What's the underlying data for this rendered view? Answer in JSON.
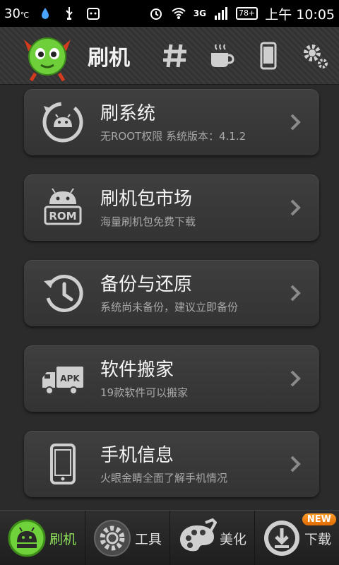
{
  "status_bar": {
    "temperature": "30",
    "network": "3G",
    "battery": "78+",
    "time": "上午 10:05"
  },
  "header": {
    "title": "刷机",
    "icons": [
      "hash-icon",
      "coffee-icon",
      "phone-icon",
      "gear-icon"
    ]
  },
  "cards": [
    {
      "title": "刷系统",
      "subtitle": "无ROOT权限 系统版本：4.1.2",
      "icon": "android-refresh-icon"
    },
    {
      "title": "刷机包市场",
      "subtitle": "海量刷机包免费下载",
      "icon": "android-rom-icon"
    },
    {
      "title": "备份与还原",
      "subtitle": "系统尚未备份，建议立即备份",
      "icon": "history-icon"
    },
    {
      "title": "软件搬家",
      "subtitle": "19款软件可以搬家",
      "icon": "apk-truck-icon"
    },
    {
      "title": "手机信息",
      "subtitle": "火眼金睛全面了解手机情况",
      "icon": "phone-info-icon"
    }
  ],
  "rom_label": "ROM",
  "apk_label": "APK",
  "bottom_nav": {
    "items": [
      {
        "label": "刷机",
        "icon": "android-icon",
        "active": true
      },
      {
        "label": "工具",
        "icon": "gear-icon"
      },
      {
        "label": "美化",
        "icon": "palette-icon"
      },
      {
        "label": "下载",
        "icon": "download-icon",
        "badge": "NEW"
      }
    ]
  },
  "colors": {
    "accent_green": "#8ee05a",
    "badge_orange": "#f08a1c"
  }
}
